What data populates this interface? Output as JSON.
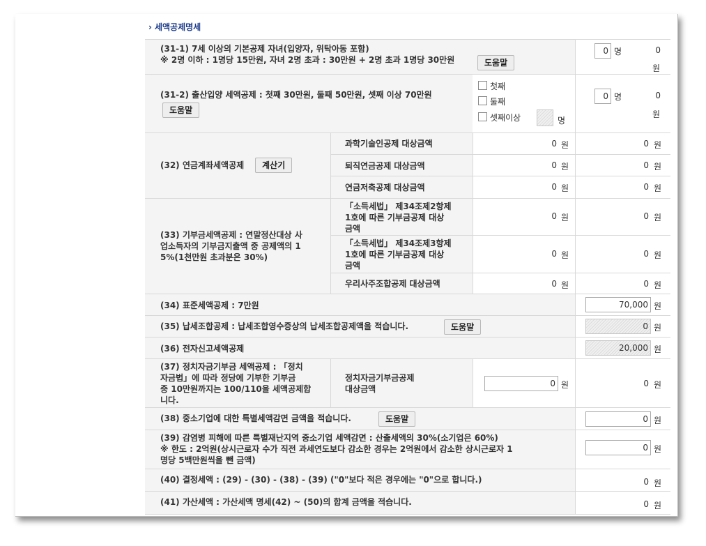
{
  "section": {
    "arrow": "›",
    "title": "세액공제명세"
  },
  "common": {
    "help": "도움말",
    "calc": "계산기",
    "won": "원",
    "person": "명",
    "zero": "0"
  },
  "r31_1": {
    "line1": "(31-1) 7세 이상의 기본공제 자녀(입양자, 위탁아동 포함)",
    "line2": "※ 2명 이하 : 1명당 15만원, 자녀 2명 초과 : 30만원 + 2명 초과 1명당 30만원",
    "count": "0",
    "amount": "0"
  },
  "r31_2": {
    "label": "(31-2) 출산입양 세액공제 : 첫째 30만원, 둘째 50만원, 셋째 이상 70만원",
    "opt1": "첫째",
    "opt2": "둘째",
    "opt3": "셋째이상",
    "count": "0",
    "amount": "0"
  },
  "r32": {
    "label": "(32) 연금계좌세액공제",
    "items": [
      {
        "name": "과학기술인공제 대상금액",
        "base": "0",
        "amount": "0"
      },
      {
        "name": "퇴직연금공제 대상금액",
        "base": "0",
        "amount": "0"
      },
      {
        "name": "연금저축공제 대상금액",
        "base": "0",
        "amount": "0"
      }
    ]
  },
  "r33": {
    "label_l1": "(33) 기부금세액공제 : 연말정산대상 사",
    "label_l2": "업소득자의 기부금지출액 중 공제액의 1",
    "label_l3": "5%(1천만원 초과분은 30%)",
    "i1": {
      "l1": "「소득세법」 제34조제2항제",
      "l2": "1호에 따른 기부금공제 대상",
      "l3": "금액",
      "base": "0",
      "amount": "0"
    },
    "i2": {
      "l1": "「소득세법」 제34조제3항제",
      "l2": "1호에 따른 기부금공제 대상",
      "l3": "금액",
      "base": "0",
      "amount": "0"
    },
    "i3": {
      "name": "우리사주조합공제 대상금액",
      "base": "0",
      "amount": "0"
    }
  },
  "r34": {
    "label": "(34) 표준세액공제 : 7만원",
    "value": "70,000"
  },
  "r35": {
    "label": "(35) 납세조합공제 : 납세조합영수증상의 납세조합공제액을 적습니다.",
    "value": "0"
  },
  "r36": {
    "label": "(36) 전자신고세액공제",
    "value": "20,000"
  },
  "r37": {
    "l1": "(37) 정치자금기부금 세액공제 : 「정치",
    "l2": "자금법」에 따라 정당에 기부한 기부금",
    "l3": "중 10만원까지는 100/110을 세액공제합",
    "l4": "니다.",
    "sub_l1": "정치자금기부금공제",
    "sub_l2": "대상금액",
    "base": "0",
    "amount": "0"
  },
  "r38": {
    "label": "(38) 중소기업에 대한 특별세액감면 금액을 적습니다.",
    "value": "0"
  },
  "r39": {
    "l1": "(39) 감염병 피해에 따른 특별재난지역 중소기업 세액감면 : 산출세액의 30%(소기업은 60%)",
    "l2": "※ 한도 : 2억원(상시근로자 수가 직전 과세연도보다 감소한 경우는 2억원에서 감소한 상시근로자 1",
    "l3": "명당 5백만원씩을 뺀 금액)",
    "value": "0"
  },
  "r40": {
    "label": "(40) 결정세액 : (29) - (30) - (38) - (39) (\"0\"보다 적은 경우에는 \"0\"으로 합니다.)",
    "value": "0"
  },
  "r41": {
    "label": "(41) 가산세액 : 가산세액 명세(42) ~ (50)의 합계 금액을 적습니다.",
    "value": "0"
  }
}
